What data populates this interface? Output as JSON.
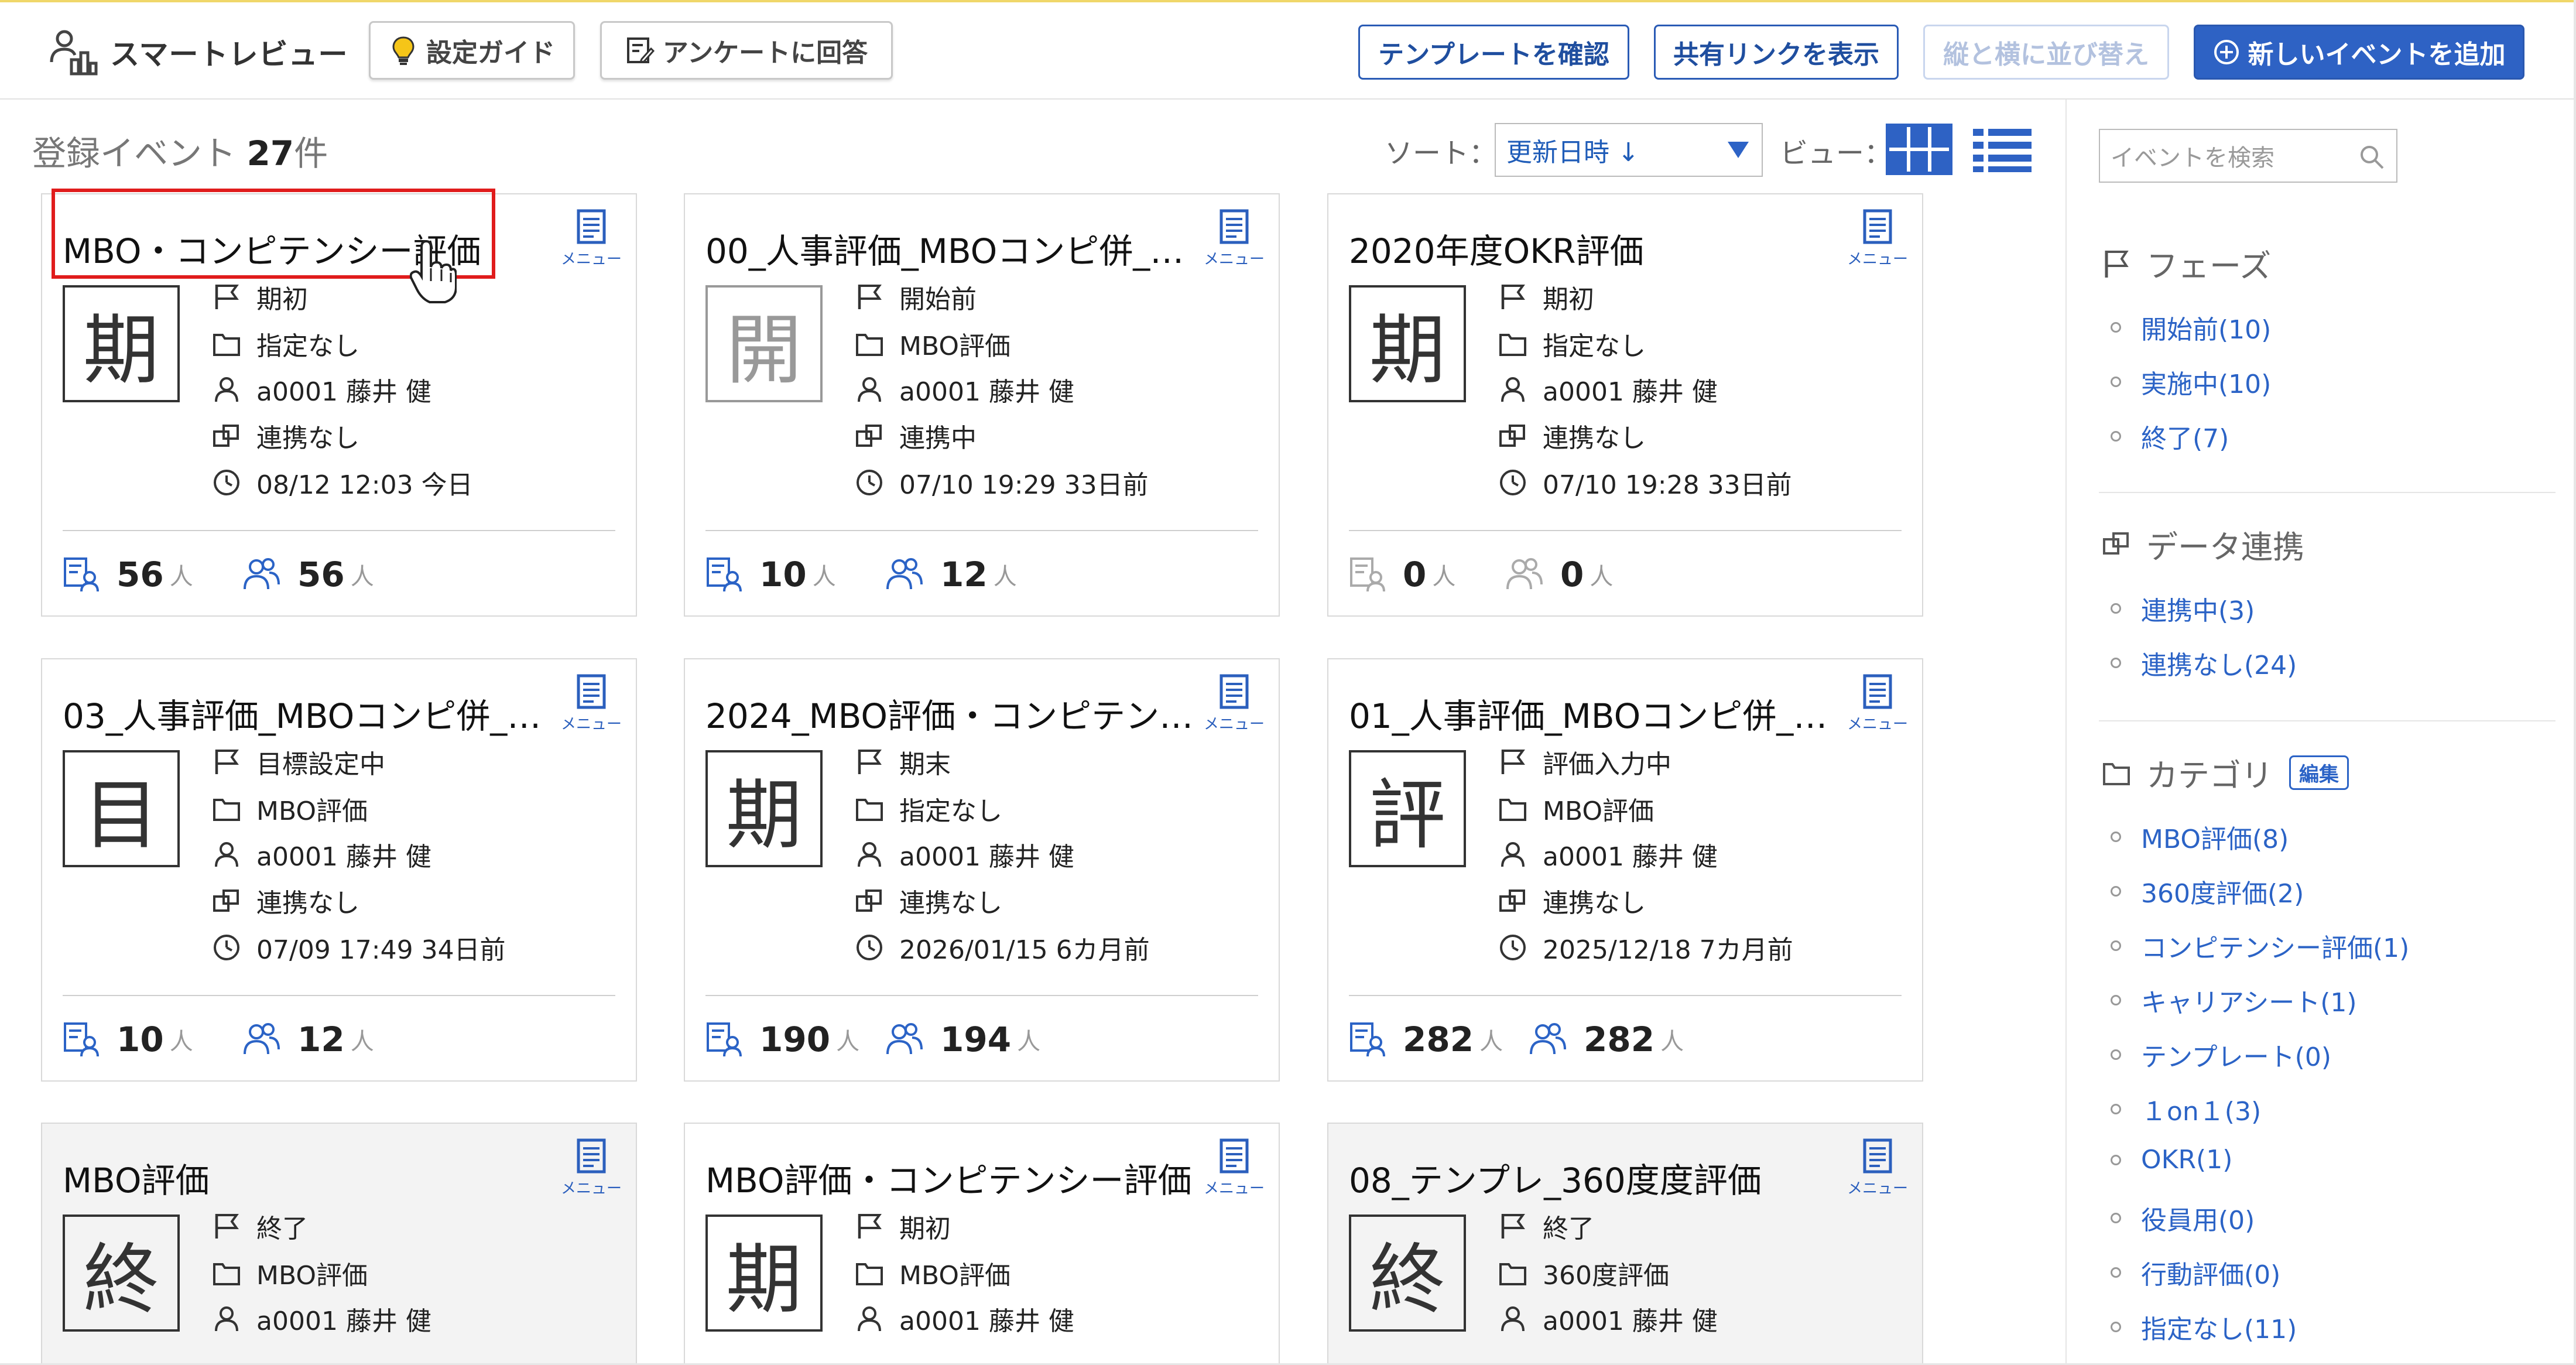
{
  "app": {
    "name": "スマートレビュー"
  },
  "toolbar": {
    "setup_guide": "設定ガイド",
    "survey": "アンケートに回答",
    "check_template": "テンプレートを確認",
    "show_share_link": "共有リンクを表示",
    "reorder": "縦と横に並び替え",
    "add_event": "新しいイベントを追加"
  },
  "main": {
    "count_prefix": "登録イベント",
    "count_value": "27",
    "count_suffix": "件",
    "sort_label": "ソート：",
    "sort_value": "更新日時 ↓",
    "view_label": "ビュー："
  },
  "card_menu_label": "メニュー",
  "person_unit": "人",
  "cards": [
    {
      "title": "MBO・コンピテンシー評価",
      "phase_char": "期",
      "phase": "期初",
      "category": "指定なし",
      "owner": "a0001 藤井 健",
      "link": "連携なし",
      "updated": "08/12 12:03 今日",
      "targets": "56",
      "evaluators": "56"
    },
    {
      "title": "00_人事評価_MBOコンピ併_…",
      "phase_char": "開",
      "phase": "開始前",
      "category": "MBO評価",
      "owner": "a0001 藤井 健",
      "link": "連携中",
      "updated": "07/10 19:29 33日前",
      "targets": "10",
      "evaluators": "12"
    },
    {
      "title": "2020年度OKR評価",
      "phase_char": "期",
      "phase": "期初",
      "category": "指定なし",
      "owner": "a0001 藤井 健",
      "link": "連携なし",
      "updated": "07/10 19:28 33日前",
      "targets": "0",
      "evaluators": "0"
    },
    {
      "title": "03_人事評価_MBOコンピ併_…",
      "phase_char": "目",
      "phase": "目標設定中",
      "category": "MBO評価",
      "owner": "a0001 藤井 健",
      "link": "連携なし",
      "updated": "07/09 17:49 34日前",
      "targets": "10",
      "evaluators": "12"
    },
    {
      "title": "2024_MBO評価・コンピテン…",
      "phase_char": "期",
      "phase": "期末",
      "category": "指定なし",
      "owner": "a0001 藤井 健",
      "link": "連携なし",
      "updated": "2026/01/15 6カ月前",
      "targets": "190",
      "evaluators": "194"
    },
    {
      "title": "01_人事評価_MBOコンピ併_…",
      "phase_char": "評",
      "phase": "評価入力中",
      "category": "MBO評価",
      "owner": "a0001 藤井 健",
      "link": "連携なし",
      "updated": "2025/12/18 7カ月前",
      "targets": "282",
      "evaluators": "282"
    },
    {
      "title": "MBO評価",
      "phase_char": "終",
      "phase": "終了",
      "category": "MBO評価",
      "owner": "a0001 藤井 健"
    },
    {
      "title": "MBO評価・コンピテンシー評価",
      "phase_char": "期",
      "phase": "期初",
      "category": "MBO評価",
      "owner": "a0001 藤井 健"
    },
    {
      "title": "08_テンプレ_360度度評価",
      "phase_char": "終",
      "phase": "終了",
      "category": "360度評価",
      "owner": "a0001 藤井 健"
    }
  ],
  "sidebar": {
    "search_placeholder": "イベントを検索",
    "phase_title": "フェーズ",
    "phase_items": [
      "開始前(10)",
      "実施中(10)",
      "終了(7)"
    ],
    "data_title": "データ連携",
    "data_items": [
      "連携中(3)",
      "連携なし(24)"
    ],
    "category_title": "カテゴリ",
    "edit_label": "編集",
    "category_items": [
      "MBO評価(8)",
      "360度評価(2)",
      "コンピテンシー評価(1)",
      "キャリアシート(1)",
      "テンプレート(0)",
      "１on１(3)",
      "OKR(1)",
      "役員用(0)",
      "行動評価(0)",
      "指定なし(11)"
    ]
  },
  "colors": {
    "accent": "#2e62c4",
    "link": "#2b63c6",
    "highlight": "#e01c1c"
  }
}
